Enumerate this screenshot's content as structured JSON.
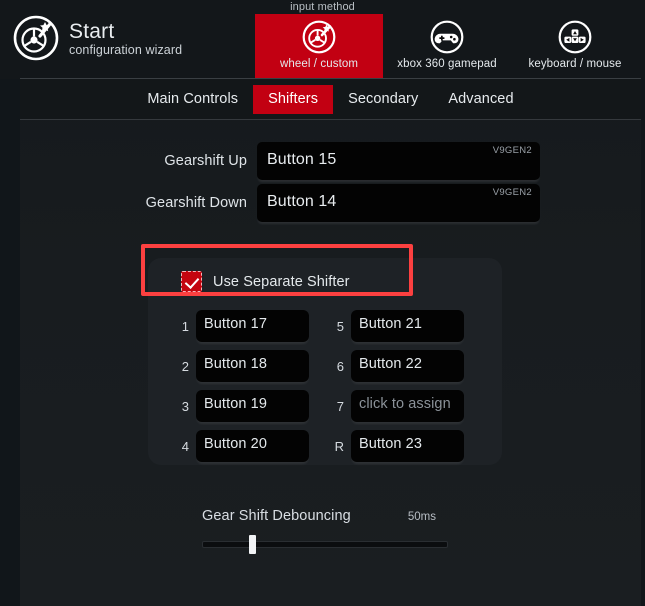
{
  "header": {
    "input_method_label": "input method",
    "brand_title": "Start",
    "brand_subtitle": "configuration wizard",
    "logo_icon": "steering-wheel-wand-icon",
    "methods": [
      {
        "label": "wheel / custom",
        "icon": "steering-wheel-icon",
        "active": true
      },
      {
        "label": "xbox 360 gamepad",
        "icon": "gamepad-icon",
        "active": false
      },
      {
        "label": "keyboard / mouse",
        "icon": "dpad-keys-icon",
        "active": false
      }
    ]
  },
  "tabs": [
    {
      "label": "Main Controls",
      "active": false
    },
    {
      "label": "Shifters",
      "active": true
    },
    {
      "label": "Secondary",
      "active": false
    },
    {
      "label": "Advanced",
      "active": false
    }
  ],
  "sequential": [
    {
      "label": "Gearshift Up",
      "value": "Button 15",
      "device": "V9GEN2"
    },
    {
      "label": "Gearshift Down",
      "value": "Button 14",
      "device": "V9GEN2"
    }
  ],
  "separate_shifter": {
    "checkbox_label": "Use Separate Shifter",
    "checked": true,
    "gears": [
      {
        "num": "1",
        "value": "Button 17",
        "placeholder": false
      },
      {
        "num": "5",
        "value": "Button 21",
        "placeholder": false
      },
      {
        "num": "2",
        "value": "Button 18",
        "placeholder": false
      },
      {
        "num": "6",
        "value": "Button 22",
        "placeholder": false
      },
      {
        "num": "3",
        "value": "Button 19",
        "placeholder": false
      },
      {
        "num": "7",
        "value": "click to assign",
        "placeholder": true
      },
      {
        "num": "4",
        "value": "Button 20",
        "placeholder": false
      },
      {
        "num": "R",
        "value": "Button 23",
        "placeholder": false
      }
    ]
  },
  "debounce": {
    "title": "Gear Shift Debouncing",
    "value": "50ms",
    "slider_percent": 20
  },
  "colors": {
    "accent_red": "#c20012",
    "annotation_red": "#fc4040",
    "background": "#15191c",
    "panel": "#1e2226",
    "field": "#030303"
  }
}
